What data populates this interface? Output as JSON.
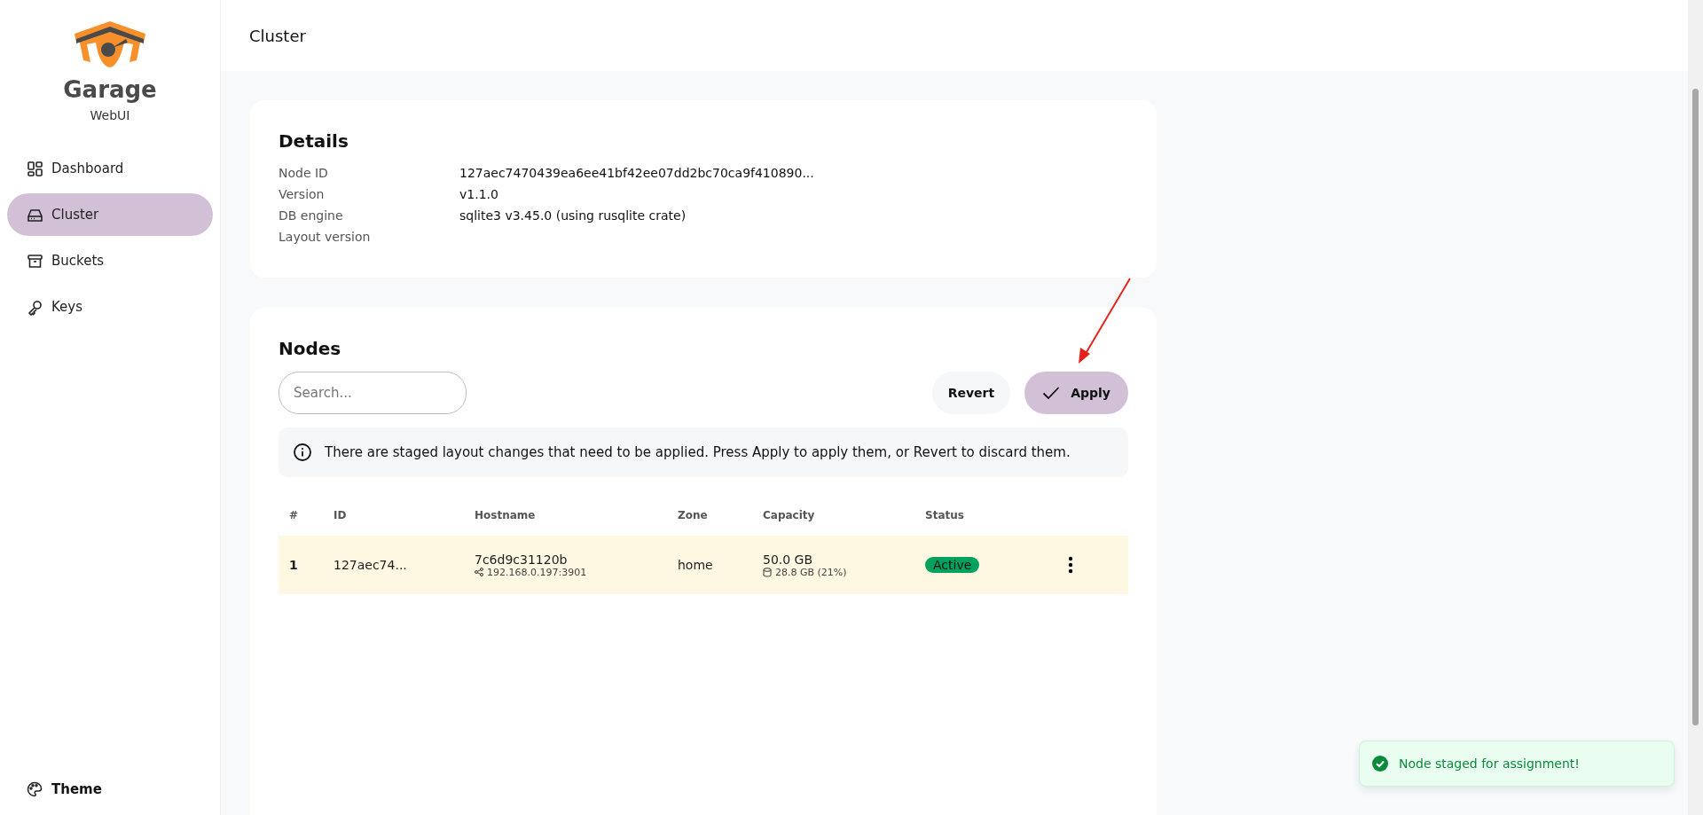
{
  "sidebar": {
    "logo_title": "Garage",
    "logo_subtitle": "WebUI",
    "items": [
      {
        "label": "Dashboard",
        "selected": false
      },
      {
        "label": "Cluster",
        "selected": true
      },
      {
        "label": "Buckets",
        "selected": false
      },
      {
        "label": "Keys",
        "selected": false
      }
    ],
    "footer": {
      "label": "Theme"
    }
  },
  "header": {
    "title": "Cluster"
  },
  "details": {
    "title": "Details",
    "rows": [
      {
        "label": "Node ID",
        "value": "127aec7470439ea6ee41bf42ee07dd2bc70ca9f410890..."
      },
      {
        "label": "Version",
        "value": "v1.1.0"
      },
      {
        "label": "DB engine",
        "value": "sqlite3 v3.45.0 (using rusqlite crate)"
      },
      {
        "label": "Layout version"
      }
    ]
  },
  "nodes": {
    "title": "Nodes",
    "search": {
      "placeholder": "Search..."
    },
    "buttons": [
      {
        "label": "Revert",
        "kind": "plain"
      },
      {
        "label": "Apply",
        "kind": "primary"
      }
    ],
    "alert": "There are staged layout changes that need to be applied. Press Apply to apply them, or Revert to discard them.",
    "columns": [
      "#",
      "ID",
      "Hostname",
      "Zone",
      "Capacity",
      "Status"
    ],
    "rows": [
      {
        "index": "1",
        "id": "127aec74...",
        "hostname": "7c6d9c31120b",
        "address": "192.168.0.197:3901",
        "zone": "home",
        "capacity": "50.0 GB",
        "usage": "28.8 GB (21%)",
        "status": "Active",
        "color": "#00a25e",
        "staged": true
      }
    ]
  },
  "toast": {
    "message": "Node staged for assignment!"
  }
}
